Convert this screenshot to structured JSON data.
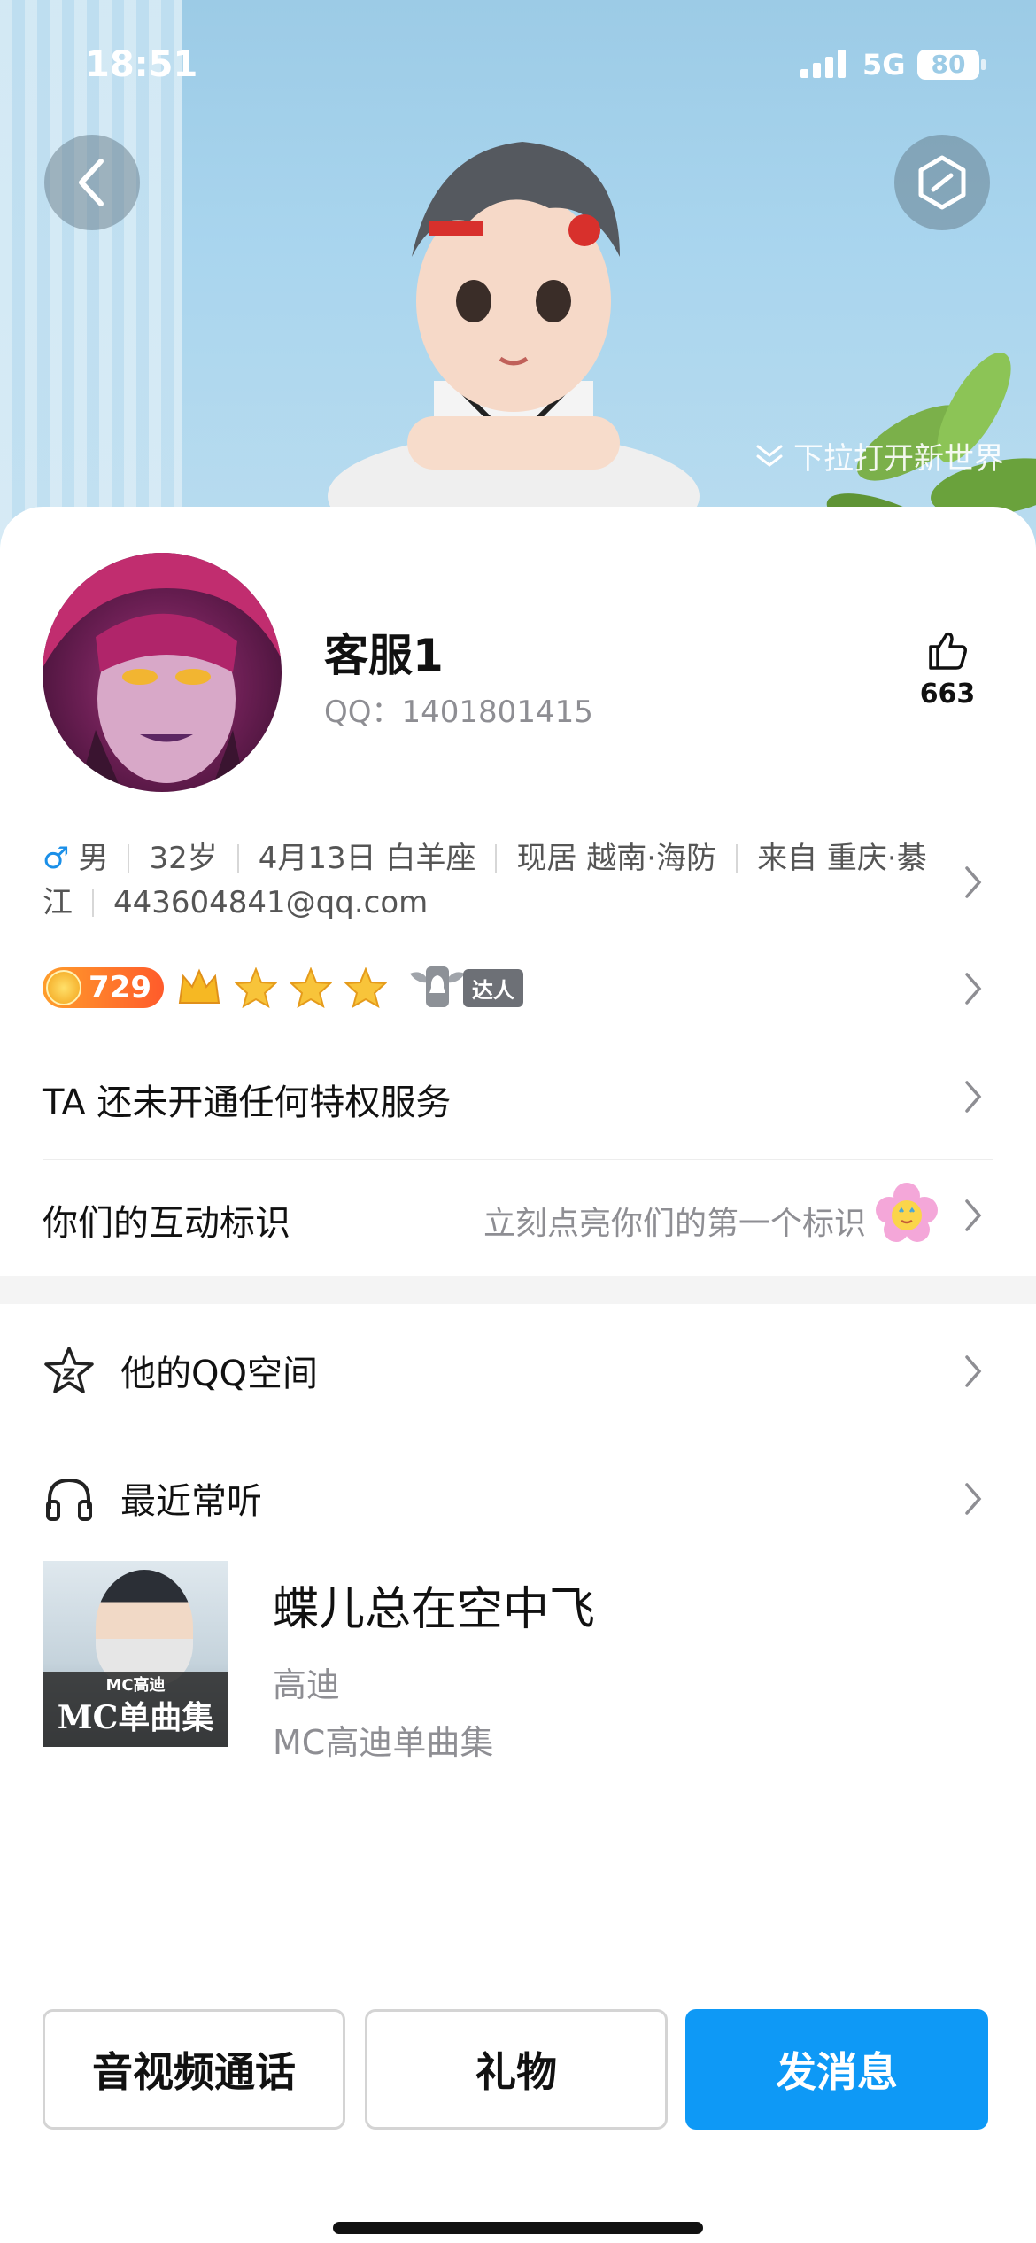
{
  "status_bar": {
    "time": "18:51",
    "network": "5G",
    "battery": "80"
  },
  "cover": {
    "pull_hint": "下拉打开新世界"
  },
  "profile": {
    "nickname": "客服1",
    "qq_label": "QQ：1401801415",
    "likes": "663"
  },
  "info": {
    "gender_symbol": "♂",
    "gender": "男",
    "age": "32岁",
    "birthday": "4月13日 白羊座",
    "residence": "现居 越南·海防",
    "hometown": "来自 重庆·綦江",
    "email": "443604841@qq.com"
  },
  "badges": {
    "level": "729",
    "daren": "达人"
  },
  "privilege": {
    "text": "TA 还未开通任何特权服务"
  },
  "interaction": {
    "label": "你们的互动标识",
    "hint": "立刻点亮你们的第一个标识"
  },
  "menu": {
    "qzone": "他的QQ空间",
    "recent_music": "最近常听"
  },
  "music": {
    "title": "蝶儿总在空中飞",
    "artist": "高迪",
    "album": "MC高迪单曲集",
    "cover_small": "MC高迪",
    "cover_big": "MC单曲集"
  },
  "actions": {
    "call": "音视频通话",
    "gift": "礼物",
    "message": "发消息"
  },
  "colors": {
    "primary": "#0e99f6",
    "male": "#1a8fe8",
    "level_orange": "#ff7a2b"
  }
}
